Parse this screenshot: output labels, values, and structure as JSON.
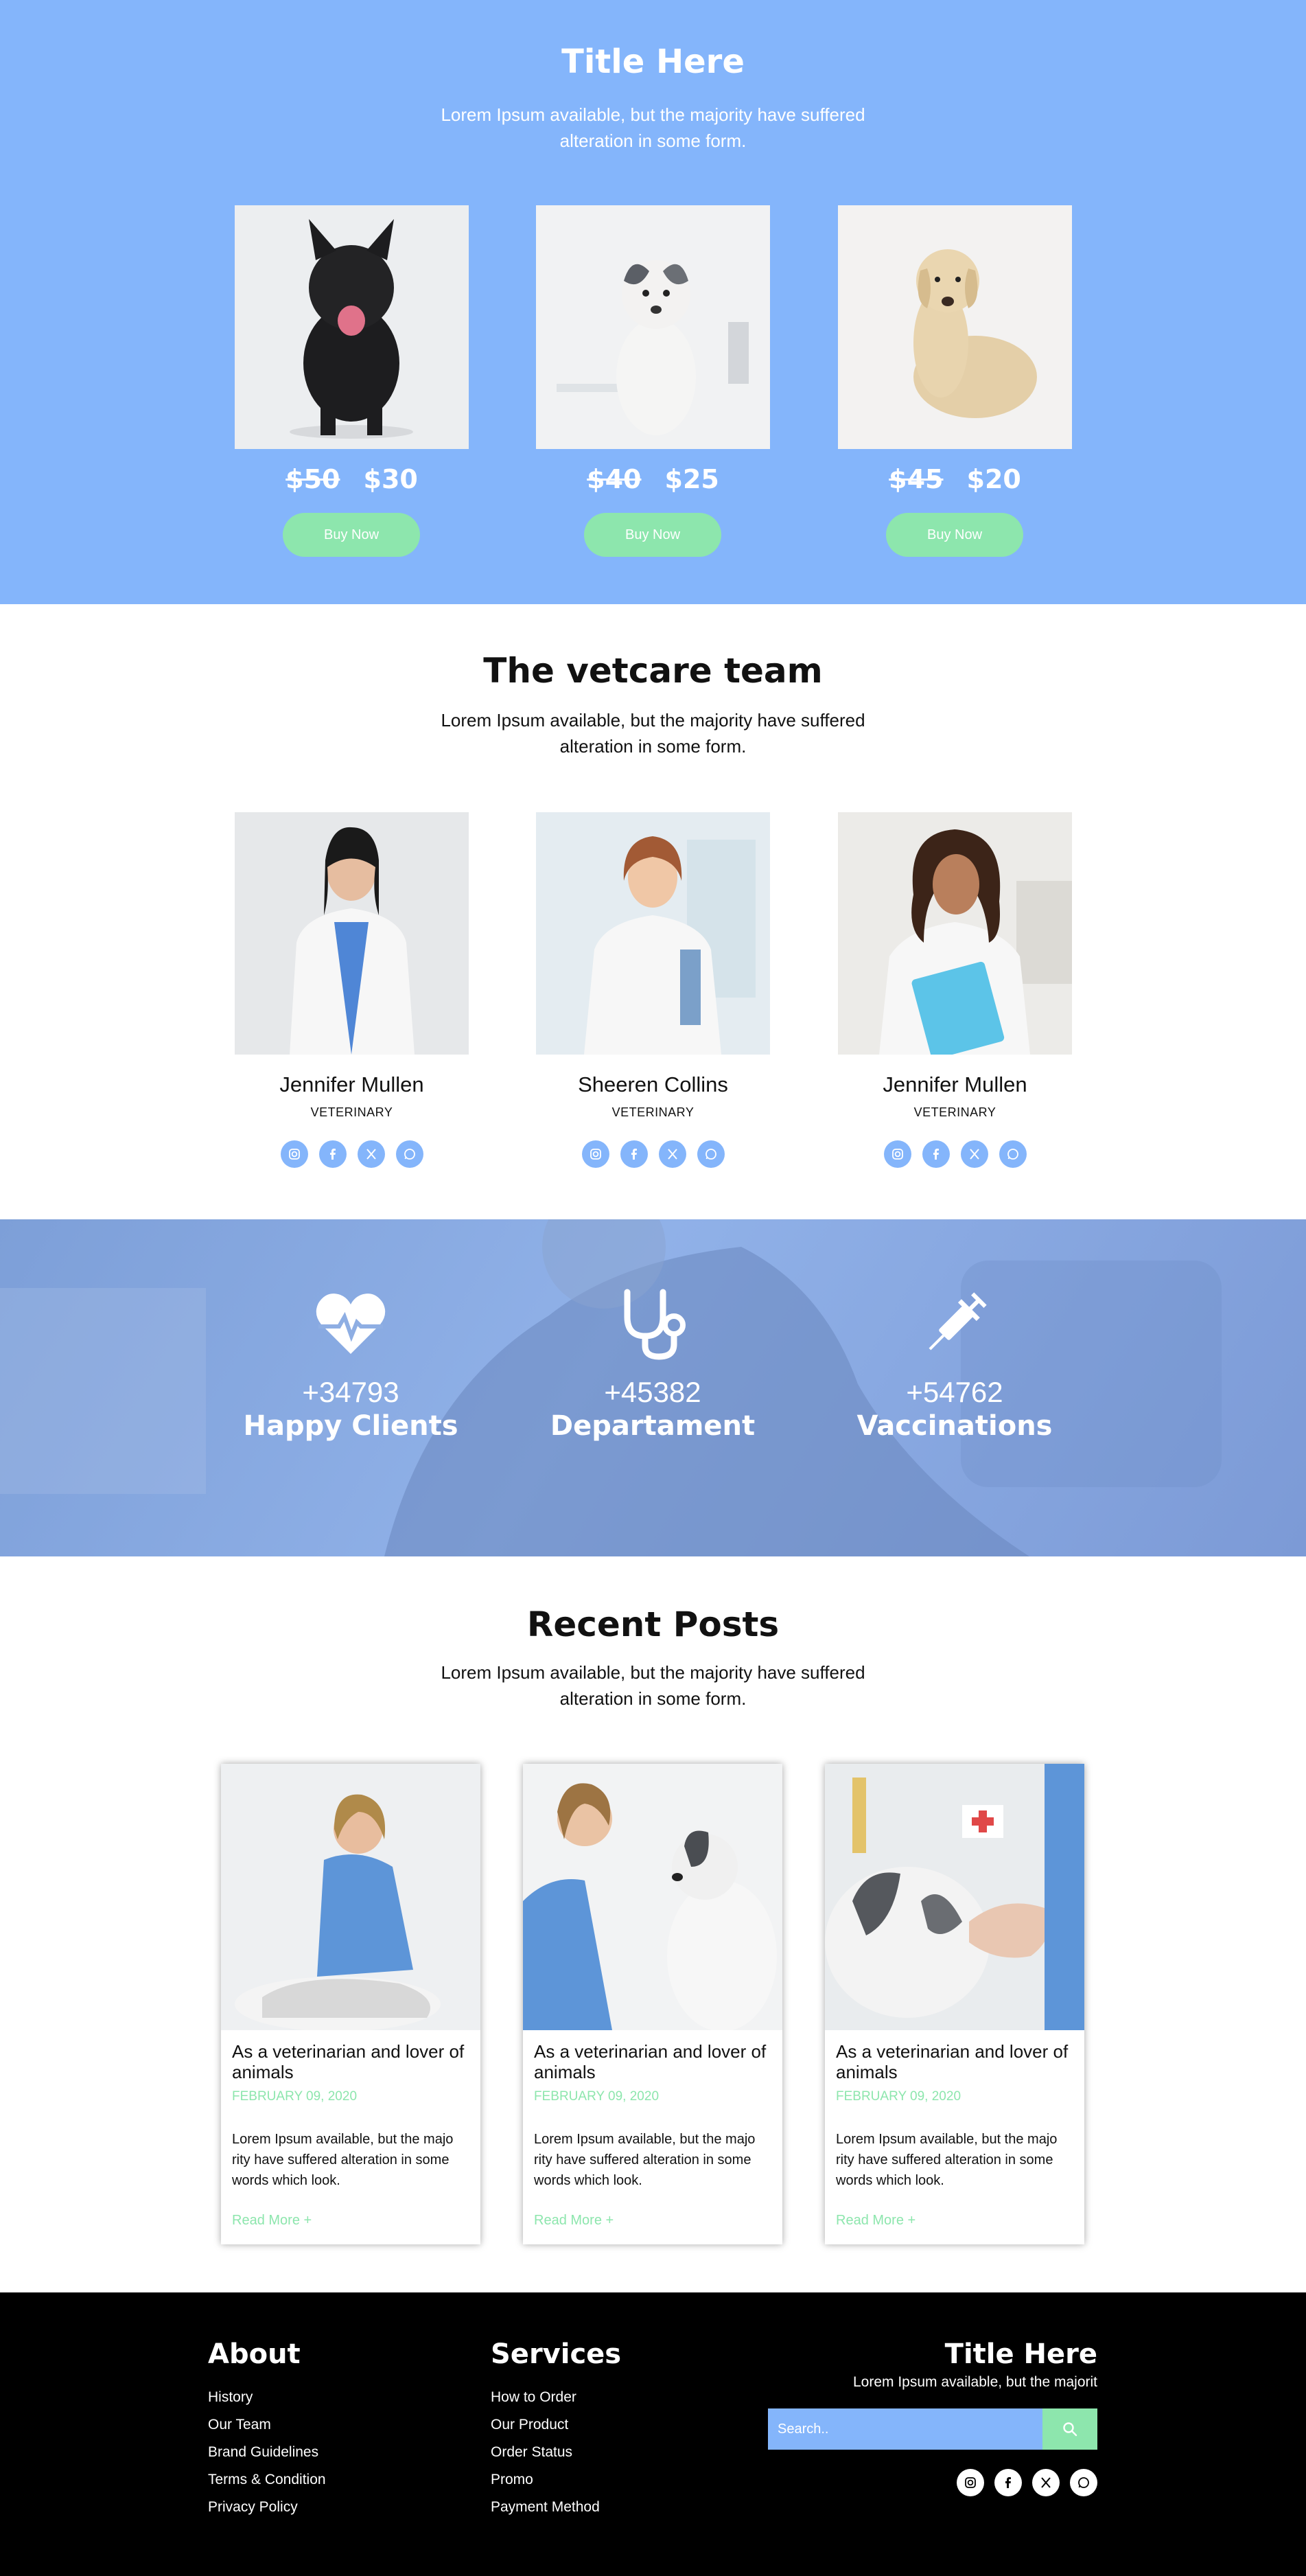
{
  "colors": {
    "primary": "#84b5fb",
    "accent": "#8de6ad",
    "footer_bg": "#000000"
  },
  "pets": {
    "title": "Title Here",
    "subtitle": "Lorem Ipsum available, but the majority have suffered alteration in some form.",
    "items": [
      {
        "image": "black-french-bulldog",
        "old_price": "$50",
        "new_price": "$30",
        "button": "Buy Now"
      },
      {
        "image": "border-collie-puppy",
        "old_price": "$40",
        "new_price": "$25",
        "button": "Buy Now"
      },
      {
        "image": "labrador-puppy",
        "old_price": "$45",
        "new_price": "$20",
        "button": "Buy Now"
      }
    ]
  },
  "team": {
    "title": "The vetcare team",
    "subtitle": "Lorem Ipsum available, but the majority have suffered alteration in some form.",
    "members": [
      {
        "name": "Jennifer Mullen",
        "role": "VETERINARY"
      },
      {
        "name": "Sheeren Collins",
        "role": "VETERINARY"
      },
      {
        "name": "Jennifer Mullen",
        "role": "VETERINARY"
      }
    ],
    "social_icons": [
      "instagram-icon",
      "facebook-icon",
      "x-icon",
      "whatsapp-icon"
    ]
  },
  "stats": [
    {
      "icon": "heartbeat-icon",
      "number": "+34793",
      "label": "Happy Clients"
    },
    {
      "icon": "stethoscope-icon",
      "number": "+45382",
      "label": "Departament"
    },
    {
      "icon": "syringe-icon",
      "number": "+54762",
      "label": "Vaccinations"
    }
  ],
  "posts": {
    "title": "Recent Posts",
    "subtitle": "Lorem Ipsum available, but the majority have suffered alteration in some form.",
    "items": [
      {
        "title": "As a veterinarian and lover of animals",
        "date": "FEBRUARY 09, 2020",
        "text": "Lorem Ipsum available, but the majo rity have suffered alteration in some words which look.",
        "more": "Read More +"
      },
      {
        "title": "As a veterinarian and lover of animals",
        "date": "FEBRUARY 09, 2020",
        "text": "Lorem Ipsum available, but the majo rity have suffered alteration in some words which look.",
        "more": "Read More +"
      },
      {
        "title": "As a veterinarian and lover of animals",
        "date": "FEBRUARY 09, 2020",
        "text": "Lorem Ipsum available, but the majo rity have suffered alteration in some words which look.",
        "more": "Read More +"
      }
    ]
  },
  "footer": {
    "about": {
      "title": "About",
      "links": [
        "History",
        "Our Team",
        "Brand Guidelines",
        "Terms & Condition",
        "Privacy Policy"
      ]
    },
    "services": {
      "title": "Services",
      "links": [
        "How to Order",
        "Our Product",
        "Order Status",
        "Promo",
        "Payment Method"
      ]
    },
    "right": {
      "title": "Title Here",
      "subtitle": "Lorem Ipsum available, but the majorit",
      "search_placeholder": "Search.."
    }
  }
}
